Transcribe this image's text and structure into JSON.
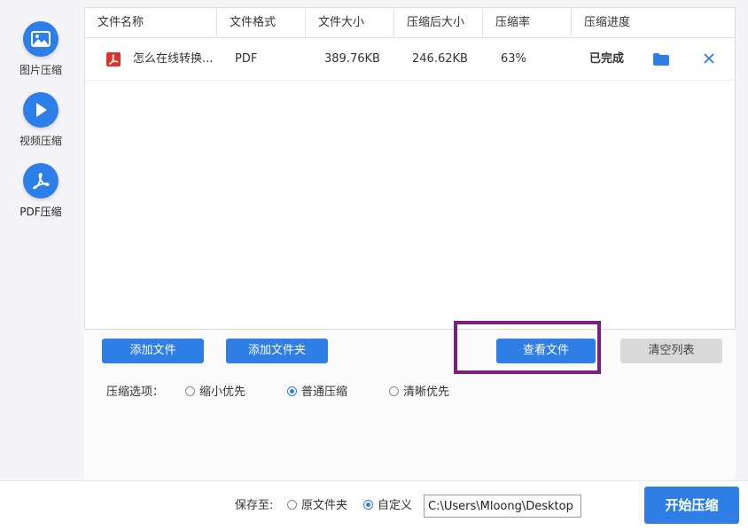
{
  "sidebar": {
    "items": [
      {
        "label": "图片压缩",
        "icon": "image-icon"
      },
      {
        "label": "视频压缩",
        "icon": "play-icon"
      },
      {
        "label": "PDF压缩",
        "icon": "pdf-icon",
        "active": true
      }
    ]
  },
  "table": {
    "headers": [
      "文件名称",
      "文件格式",
      "文件大小",
      "压缩后大小",
      "压缩率",
      "压缩进度"
    ],
    "rows": [
      {
        "name": "怎么在线转换...",
        "format": "PDF",
        "size": "389.76KB",
        "compressed": "246.62KB",
        "ratio": "63%",
        "status": "已完成"
      }
    ]
  },
  "buttons": {
    "add_file": "添加文件",
    "add_folder": "添加文件夹",
    "view_file": "查看文件",
    "clear_list": "清空列表"
  },
  "options": {
    "label": "压缩选项：",
    "choices": [
      {
        "label": "缩小优先",
        "checked": false
      },
      {
        "label": "普通压缩",
        "checked": true
      },
      {
        "label": "清晰优先",
        "checked": false
      }
    ]
  },
  "footer": {
    "save_label": "保存至:",
    "original_folder": "原文件夹",
    "custom": "自定义",
    "path_value": "C:\\Users\\Mloong\\Desktop",
    "start_button": "开始压缩"
  },
  "colors": {
    "accent": "#2e7ee6",
    "highlight": "#7a1f7a"
  }
}
